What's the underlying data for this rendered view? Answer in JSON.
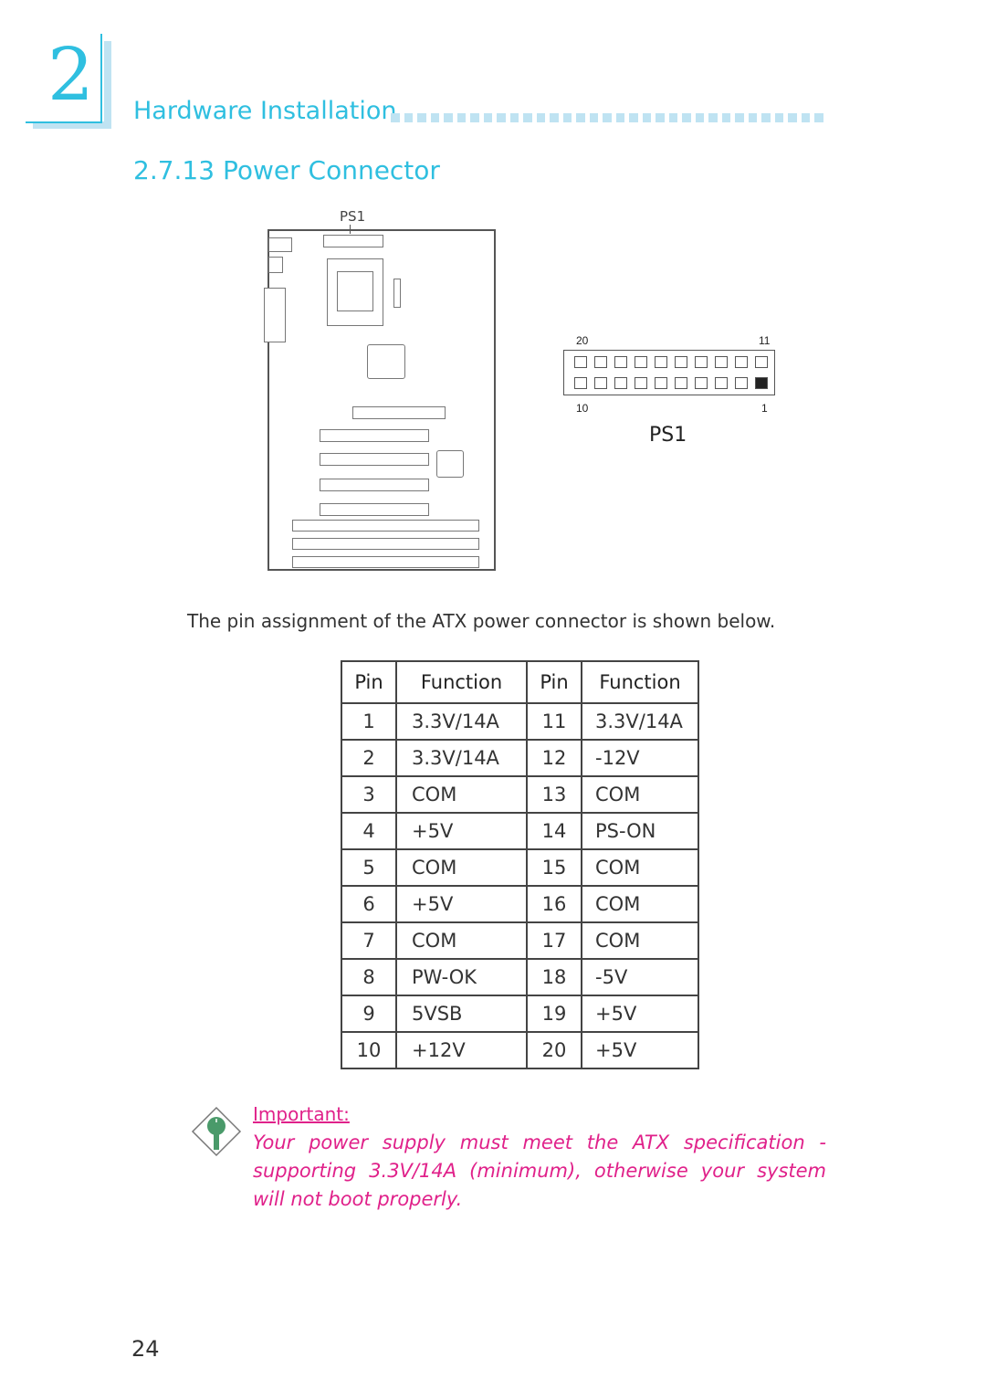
{
  "chapter": {
    "number": "2",
    "title": "Hardware Installation"
  },
  "section": {
    "title": "2.7.13  Power Connector"
  },
  "board_diagram": {
    "connector_label": "PS1"
  },
  "connector_diagram": {
    "label": "PS1",
    "corner_labels": {
      "top_left": "20",
      "top_right": "11",
      "bottom_left": "10",
      "bottom_right": "1"
    },
    "pin1_marked": true
  },
  "intro_text": "The pin assignment of the ATX power connector is shown below.",
  "pin_table": {
    "headers": [
      "Pin",
      "Function",
      "Pin",
      "Function"
    ],
    "rows": [
      [
        "1",
        "3.3V/14A",
        "11",
        "3.3V/14A"
      ],
      [
        "2",
        "3.3V/14A",
        "12",
        "-12V"
      ],
      [
        "3",
        "COM",
        "13",
        "COM"
      ],
      [
        "4",
        "+5V",
        "14",
        "PS-ON"
      ],
      [
        "5",
        "COM",
        "15",
        "COM"
      ],
      [
        "6",
        "+5V",
        "16",
        "COM"
      ],
      [
        "7",
        "COM",
        "17",
        "COM"
      ],
      [
        "8",
        "PW-OK",
        "18",
        "-5V"
      ],
      [
        "9",
        "5VSB",
        "19",
        "+5V"
      ],
      [
        "10",
        "+12V",
        "20",
        "+5V"
      ]
    ]
  },
  "note": {
    "icon": "key-icon",
    "heading": "Important:",
    "body": "Your power supply must meet the ATX specification - supporting 3.3V/14A (minimum), otherwise your system will not boot properly."
  },
  "page_number": "24",
  "colors": {
    "accent": "#2fbfe0",
    "accent_light": "#bfe3f2",
    "note": "#e0218a",
    "icon_green": "#4a9a6a"
  }
}
